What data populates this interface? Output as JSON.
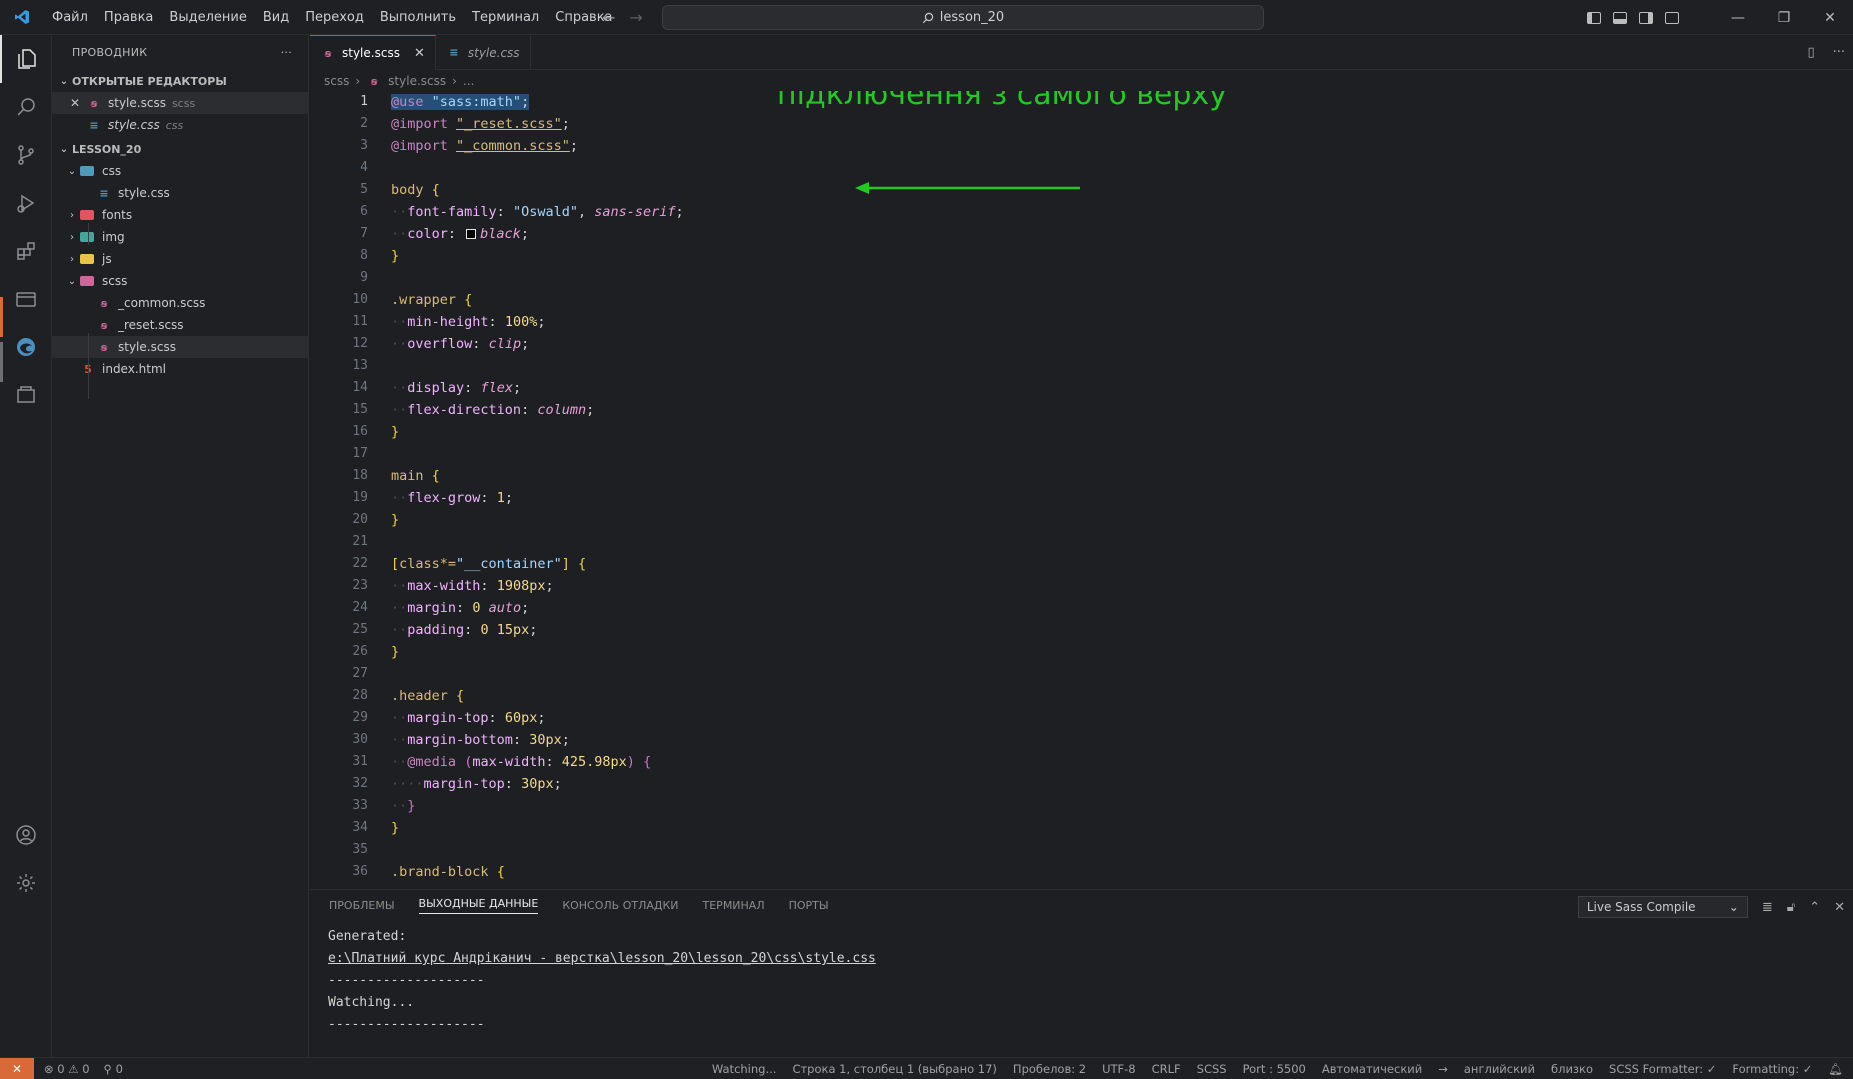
{
  "titlebar": {
    "menu": [
      "Файл",
      "Правка",
      "Выделение",
      "Вид",
      "Переход",
      "Выполнить",
      "Терминал",
      "Справка"
    ],
    "search_text": "lesson_20",
    "window_controls": [
      "—",
      "❐",
      "✕"
    ]
  },
  "sidebar": {
    "title": "ПРОВОДНИК",
    "more": "···",
    "open_editors_label": "ОТКРЫТЫЕ РЕДАКТОРЫ",
    "open_editors": [
      {
        "name": "style.scss",
        "dir": "scss",
        "icon": "scss-file-icon",
        "closable": true
      },
      {
        "name": "style.css",
        "dir": "css",
        "icon": "css-file-icon",
        "closable": false
      }
    ],
    "project_label": "LESSON_20",
    "tree": [
      {
        "name": "css",
        "type": "folder",
        "open": true,
        "color": "#519aba"
      },
      {
        "name": "style.css",
        "type": "css"
      },
      {
        "name": "fonts",
        "type": "folder",
        "open": false,
        "color": "#e05561"
      },
      {
        "name": "img",
        "type": "folder",
        "open": false,
        "color": "#3fa89a"
      },
      {
        "name": "js",
        "type": "folder",
        "open": false,
        "color": "#e8c547"
      },
      {
        "name": "scss",
        "type": "folder",
        "open": true,
        "color": "#cd6799"
      },
      {
        "name": "_common.scss",
        "type": "scss"
      },
      {
        "name": "_reset.scss",
        "type": "scss"
      },
      {
        "name": "style.scss",
        "type": "scss"
      },
      {
        "name": "index.html",
        "type": "html"
      }
    ]
  },
  "tabs": [
    {
      "label": "style.scss",
      "active": true
    },
    {
      "label": "style.css",
      "active": false
    }
  ],
  "breadcrumb": [
    "scss",
    "style.scss",
    "..."
  ],
  "editor": {
    "line_numbers": [
      "1",
      "2",
      "3",
      "4",
      "5",
      "6",
      "7",
      "8",
      "9",
      "10",
      "11",
      "12",
      "13",
      "14",
      "15",
      "16",
      "17",
      "18",
      "19",
      "20",
      "21",
      "22",
      "23",
      "24",
      "25",
      "26",
      "27",
      "28",
      "29",
      "30",
      "31",
      "32",
      "33",
      "34",
      "35",
      "36"
    ],
    "annotation": "підключення з самого верху"
  },
  "panel": {
    "tabs": [
      "ПРОБЛЕМЫ",
      "ВЫХОДНЫЕ ДАННЫЕ",
      "КОНСОЛЬ ОТЛАДКИ",
      "ТЕРМИНАЛ",
      "ПОРТЫ"
    ],
    "active_tab": "ВЫХОДНЫЕ ДАННЫЕ",
    "channel": "Live Sass Compile",
    "output": [
      "Generated:",
      "e:\\Платний курс Андріканич - верстка\\lesson_20\\lesson_20\\css\\style.css",
      "--------------------",
      "Watching...",
      "--------------------"
    ]
  },
  "status": {
    "errors": "⊗ 0 ⚠ 0",
    "ports": "⚲ 0",
    "items": [
      "Watching...",
      "Строка 1, столбец 1 (выбрано 17)",
      "Пробелов: 2",
      "UTF-8",
      "CRLF",
      "SCSS",
      "Port : 5500",
      "Автоматический",
      "→",
      "английский",
      "близко",
      "SCSS Formatter: ✓",
      "Formatting: ✓"
    ]
  }
}
